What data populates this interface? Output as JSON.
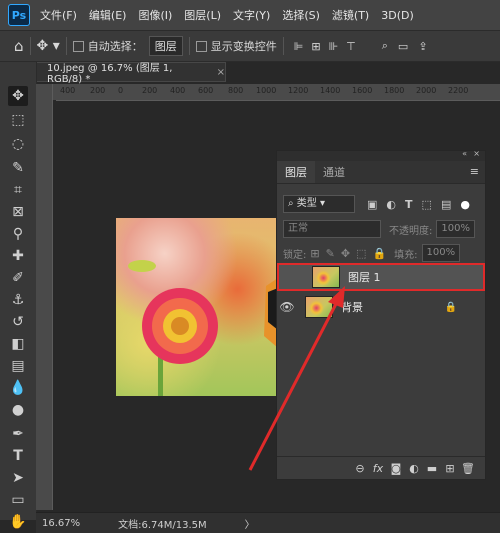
{
  "app": {
    "logo": "Ps"
  },
  "menu": [
    "文件(F)",
    "编辑(E)",
    "图像(I)",
    "图层(L)",
    "文字(Y)",
    "选择(S)",
    "滤镜(T)",
    "3D(D)"
  ],
  "options": {
    "auto_select_label": "自动选择：",
    "auto_select_value": "图层",
    "show_transform_label": "显示变换控件"
  },
  "document": {
    "tab_title": "10.jpeg @ 16.7% (图层 1, RGB/8) *"
  },
  "ruler": {
    "ticks": [
      "400",
      "200",
      "0",
      "200",
      "400",
      "600",
      "800",
      "1000",
      "1200",
      "1400",
      "1600",
      "1800",
      "2000",
      "2200"
    ]
  },
  "status": {
    "zoom": "16.67%",
    "doc_info": "文档:6.74M/13.5M"
  },
  "layers_panel": {
    "tabs": [
      "图层",
      "通道"
    ],
    "filter_kind": "类型",
    "blend_mode": "正常",
    "opacity_label": "不透明度:",
    "opacity_value": "100%",
    "lock_label": "锁定:",
    "fill_label": "填充:",
    "fill_value": "100%",
    "layers": [
      {
        "name": "图层 1",
        "selected": true,
        "visible": false
      },
      {
        "name": "背景",
        "selected": false,
        "visible": true,
        "locked": true
      }
    ],
    "bottom_icons": [
      "link-icon",
      "fx-icon",
      "mask-icon",
      "adjustment-icon",
      "folder-icon",
      "new-layer-icon",
      "trash-icon"
    ],
    "bottom_labels": [
      "⊖",
      "fx",
      "◙",
      "◐",
      "▬",
      "⊞",
      "🗑"
    ]
  },
  "annotation": {
    "color": "#e02a2a"
  }
}
